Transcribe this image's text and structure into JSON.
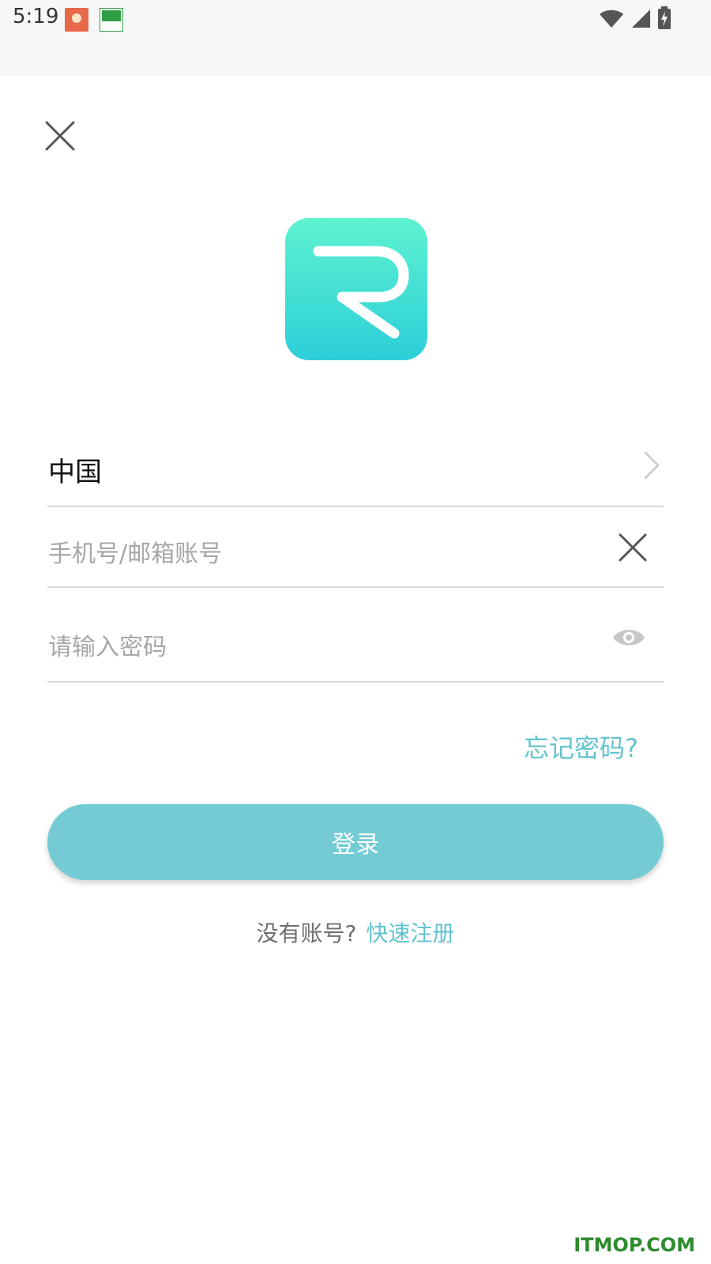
{
  "status_bar": {
    "time": "5:19",
    "notification_icons": [
      "app-icon-avatar",
      "app-icon-drone"
    ],
    "system_icons": [
      "wifi-icon",
      "signal-icon",
      "battery-charging-icon"
    ]
  },
  "header": {
    "close_icon": "close-icon"
  },
  "logo": {
    "icon": "app-logo-r",
    "gradient_top": "#5ef2cf",
    "gradient_bottom": "#2ccfd9"
  },
  "form": {
    "country_label": "中国",
    "account_placeholder": "手机号/邮箱账号",
    "password_placeholder": "请输入密码",
    "forgot_password": "忘记密码?",
    "login_label": "登录"
  },
  "register": {
    "question": "没有账号?",
    "link": "快速注册"
  },
  "watermark": "ITMOP.COM",
  "colors": {
    "accent": "#63c3cf",
    "button": "#74cbd4",
    "divider": "#d9d9d9",
    "placeholder": "#a7a7a7"
  }
}
